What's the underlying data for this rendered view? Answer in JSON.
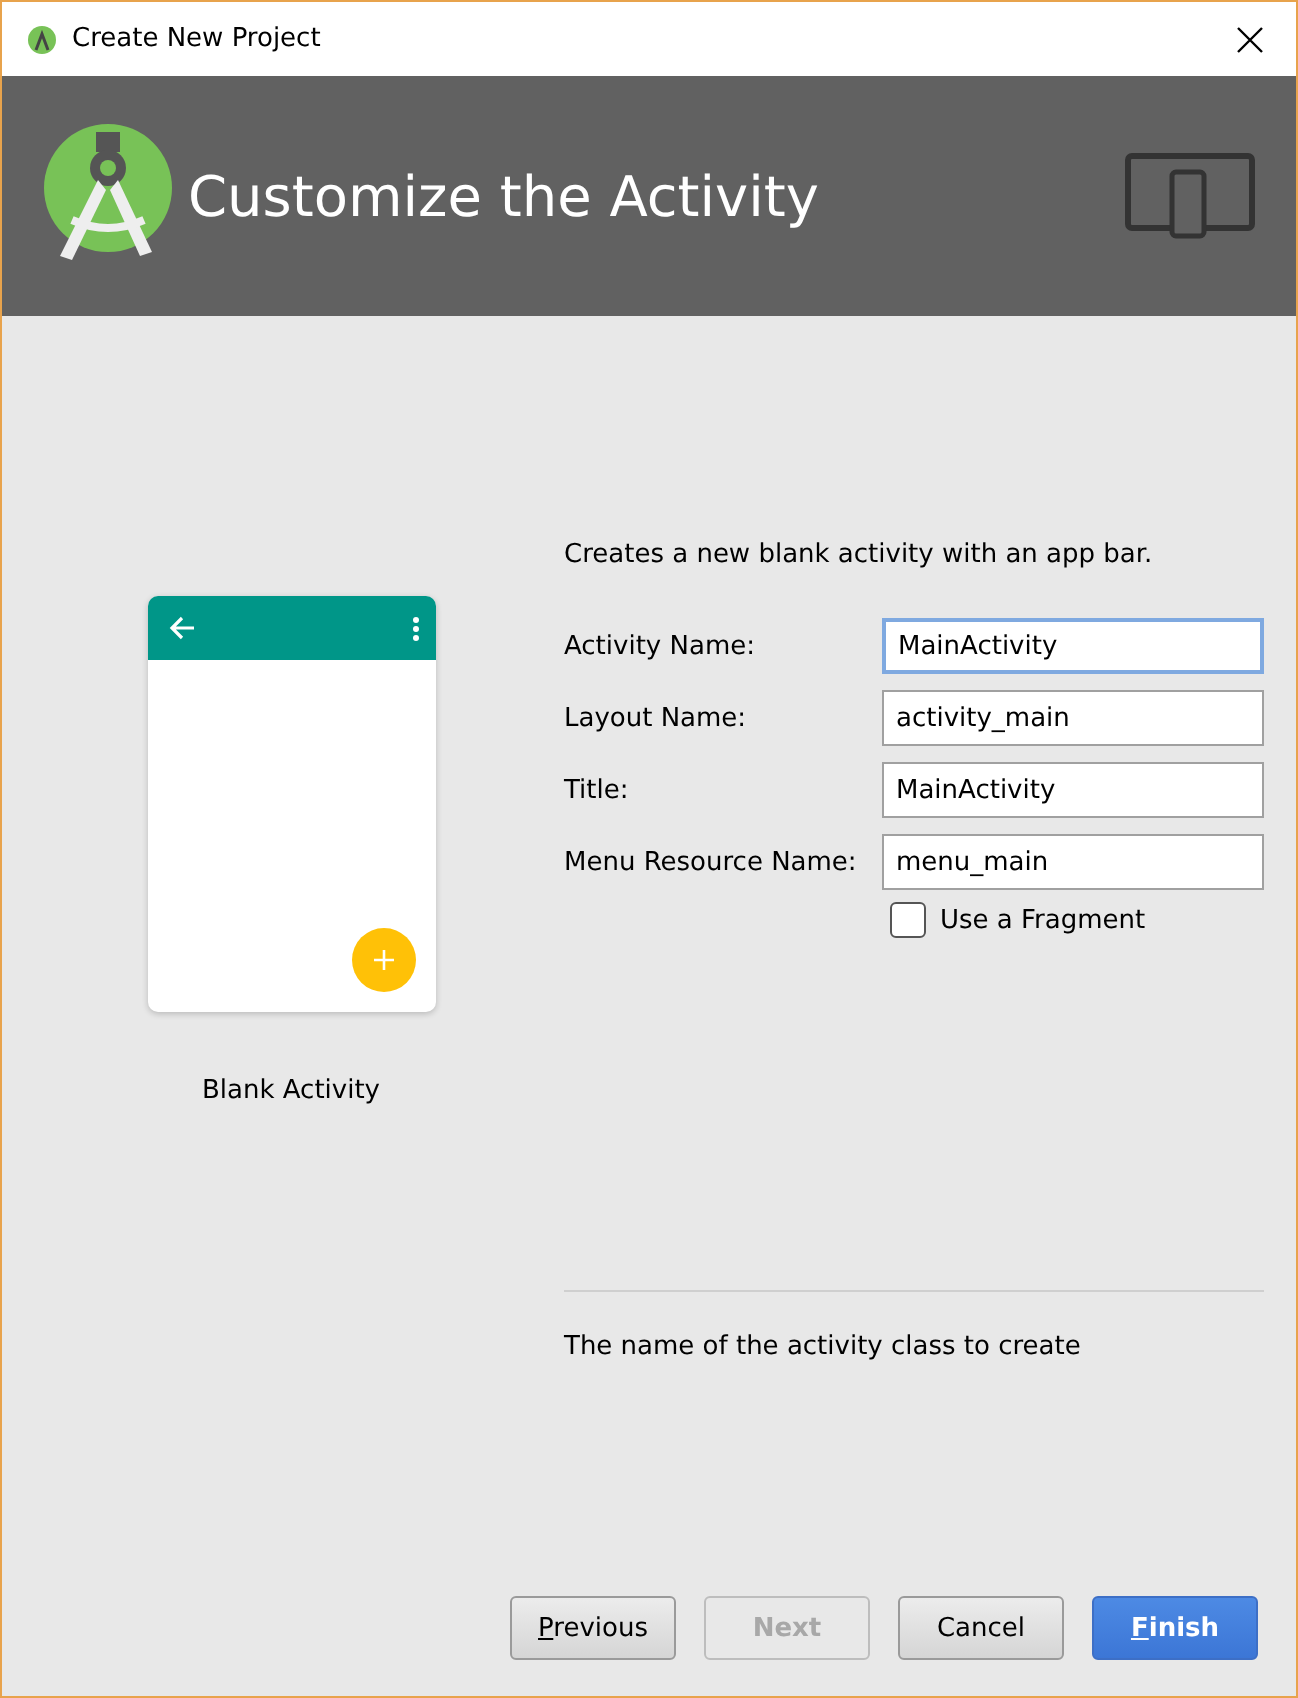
{
  "window": {
    "title": "Create New Project"
  },
  "header": {
    "title": "Customize the Activity"
  },
  "template": {
    "name": "Blank Activity"
  },
  "description": "Creates a new blank activity with an app bar.",
  "fields": [
    {
      "label": "Activity Name:",
      "value": "MainActivity",
      "focused": true
    },
    {
      "label": "Layout Name:",
      "value": "activity_main",
      "focused": false
    },
    {
      "label": "Title:",
      "value": "MainActivity",
      "focused": false
    },
    {
      "label": "Menu Resource Name:",
      "value": "menu_main",
      "focused": false
    }
  ],
  "fragment_checkbox": {
    "label": "Use a Fragment",
    "checked": false
  },
  "help_text": "The name of the activity class to create",
  "buttons": [
    {
      "label": "Previous",
      "disabled": false,
      "primary": false,
      "mnemonic": true
    },
    {
      "label": "Next",
      "disabled": true,
      "primary": false,
      "mnemonic": false
    },
    {
      "label": "Cancel",
      "disabled": false,
      "primary": false,
      "mnemonic": false
    },
    {
      "label": "Finish",
      "disabled": false,
      "primary": true,
      "mnemonic": true
    }
  ]
}
